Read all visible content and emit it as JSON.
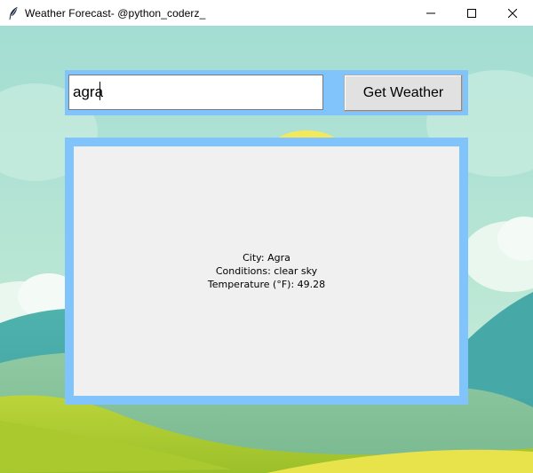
{
  "window": {
    "title": "Weather Forecast- @python_coderz_",
    "icon": "feather-icon",
    "controls": [
      "minimize-icon",
      "maximize-icon",
      "close-icon"
    ]
  },
  "search": {
    "value": "agra",
    "button_label": "Get Weather"
  },
  "result": {
    "city_line": "City: Agra",
    "conditions_line": "Conditions: clear sky",
    "temperature_line": "Temperature (°F): 49.28"
  },
  "colors": {
    "frame": "#80c4fb",
    "panel": "#f0f0f0",
    "button": "#e1e1e1"
  }
}
